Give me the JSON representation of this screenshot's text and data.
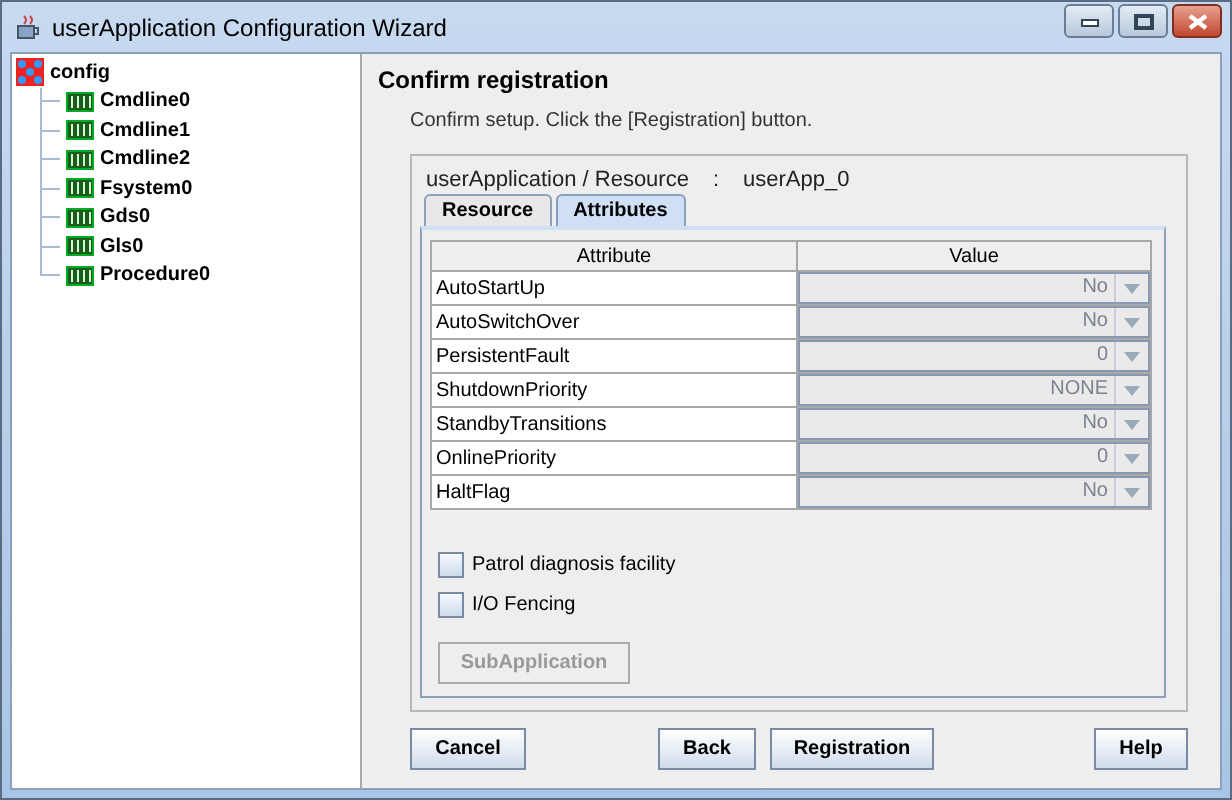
{
  "window": {
    "title": "userApplication Configuration Wizard"
  },
  "tree": {
    "label": "config",
    "children": [
      {
        "label": "Cmdline0"
      },
      {
        "label": "Cmdline1"
      },
      {
        "label": "Cmdline2"
      },
      {
        "label": "Fsystem0"
      },
      {
        "label": "Gds0"
      },
      {
        "label": "Gls0"
      },
      {
        "label": "Procedure0"
      }
    ]
  },
  "heading": "Confirm registration",
  "instruction": "Confirm setup.  Click the [Registration] button.",
  "resource": {
    "label": "userApplication / Resource",
    "separator": ":",
    "value": "userApp_0"
  },
  "tabs": [
    {
      "label": "Resource",
      "selected": false
    },
    {
      "label": "Attributes",
      "selected": true
    }
  ],
  "table": {
    "columns": [
      "Attribute",
      "Value"
    ],
    "rows": [
      {
        "attribute": "AutoStartUp",
        "value": "No",
        "disabled": true
      },
      {
        "attribute": "AutoSwitchOver",
        "value": "No",
        "disabled": true
      },
      {
        "attribute": "PersistentFault",
        "value": "0",
        "disabled": true
      },
      {
        "attribute": "ShutdownPriority",
        "value": "NONE",
        "disabled": true
      },
      {
        "attribute": "StandbyTransitions",
        "value": "No",
        "disabled": true
      },
      {
        "attribute": "OnlinePriority",
        "value": "0",
        "disabled": true
      },
      {
        "attribute": "HaltFlag",
        "value": "No",
        "disabled": true
      }
    ]
  },
  "checkboxes": [
    {
      "label": "Patrol diagnosis facility",
      "checked": false
    },
    {
      "label": "I/O Fencing",
      "checked": false
    }
  ],
  "sub_button": {
    "label": "SubApplication",
    "disabled": true
  },
  "buttons": [
    {
      "label": "Cancel"
    },
    {
      "label": "Back"
    },
    {
      "label": "Registration"
    },
    {
      "label": "Help"
    }
  ]
}
